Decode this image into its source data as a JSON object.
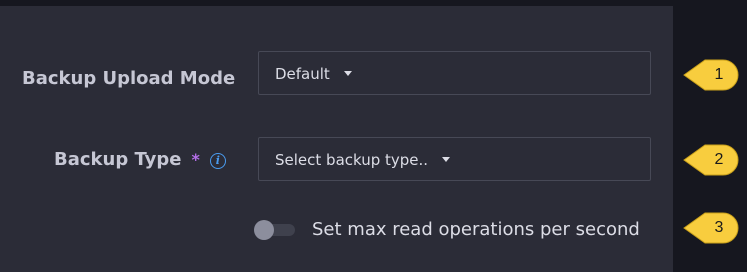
{
  "form": {
    "upload_mode": {
      "label": "Backup Upload Mode",
      "value": "Default"
    },
    "backup_type": {
      "label": "Backup Type",
      "required_marker": "*",
      "info_icon": "info-circle-icon",
      "value": "Select backup type.."
    },
    "max_read_ops": {
      "label": "Set max read operations per second",
      "enabled": false
    }
  },
  "callouts": [
    "1",
    "2",
    "3"
  ],
  "colors": {
    "page_background": "#16171f",
    "panel_background": "#2b2c37",
    "label_text": "#c6c7d4",
    "required_asterisk": "#b36ee8",
    "info_icon": "#4a9cf0",
    "callout_fill": "#f8cd3e"
  }
}
